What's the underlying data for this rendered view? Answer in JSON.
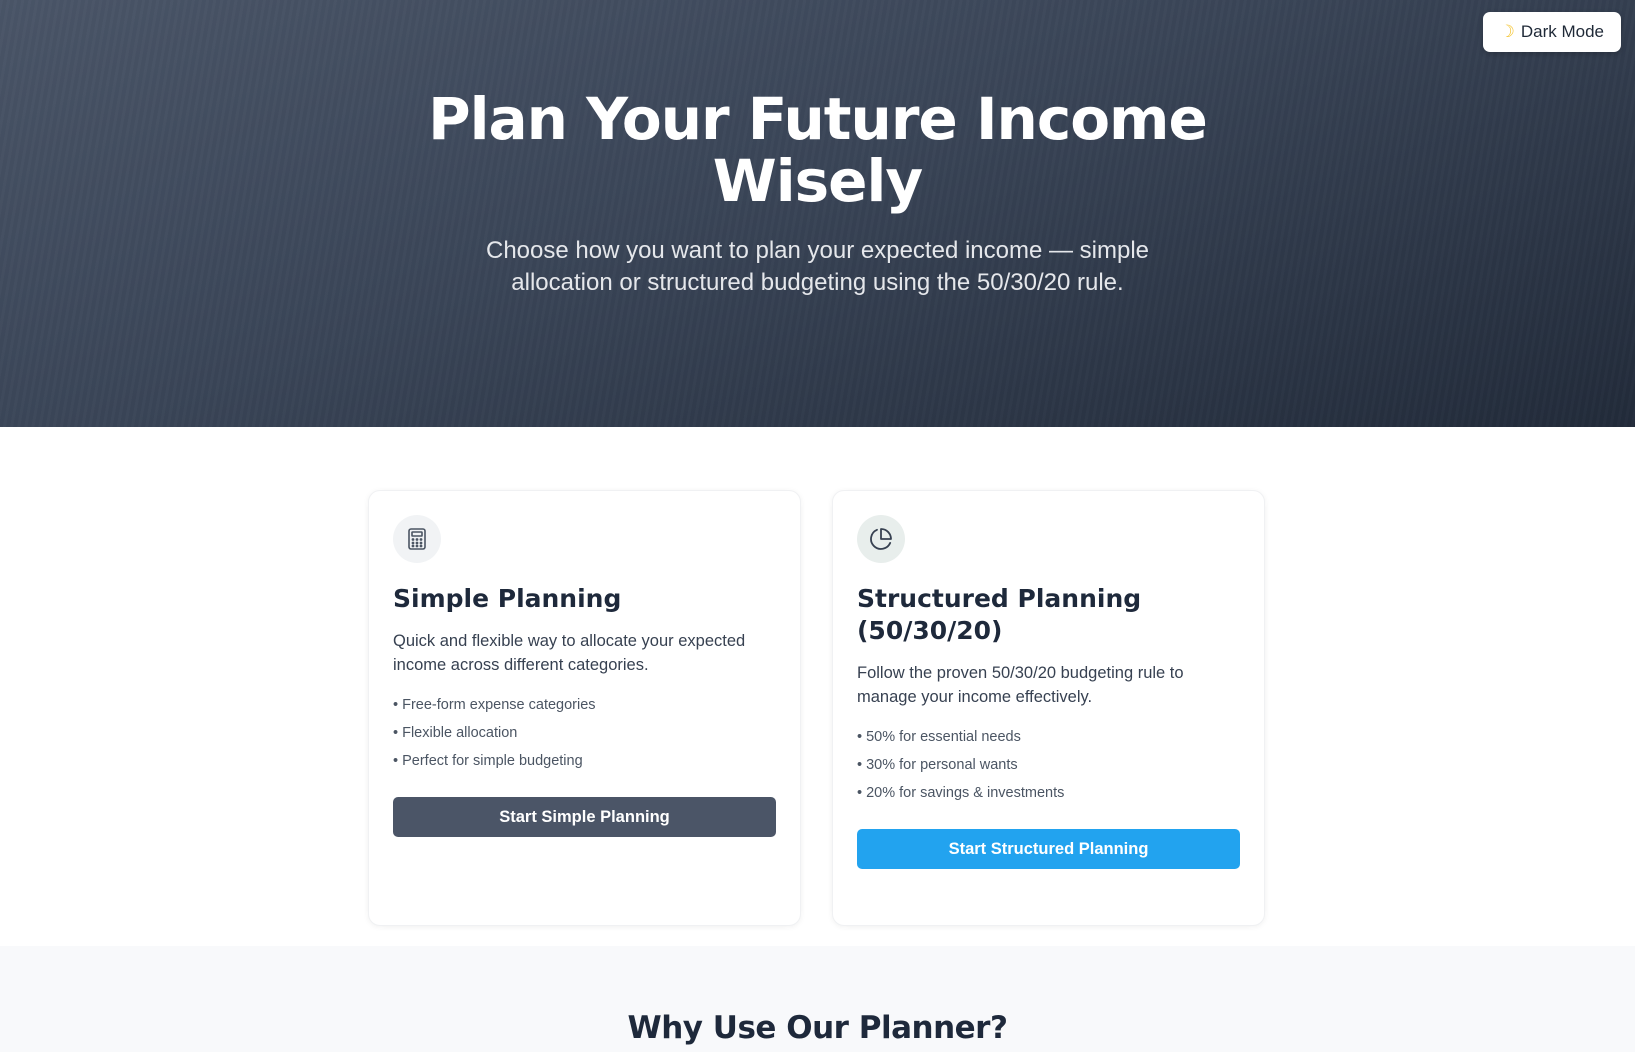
{
  "theme_toggle": {
    "icon": "moon-icon",
    "label": "Dark Mode"
  },
  "hero": {
    "title": "Plan Your Future Income Wisely",
    "subtitle": "Choose how you want to plan your expected income — simple allocation or structured budgeting using the 50/30/20 rule."
  },
  "cards": [
    {
      "icon": "calculator-icon",
      "title": "Simple Planning",
      "description": "Quick and flexible way to allocate your expected income across different categories.",
      "features": [
        "• Free-form expense categories",
        "• Flexible allocation",
        "• Perfect for simple budgeting"
      ],
      "button_label": "Start Simple Planning",
      "button_color": "#4b5567"
    },
    {
      "icon": "pie-chart-icon",
      "title": "Structured Planning (50/30/20)",
      "description": "Follow the proven 50/30/20 budgeting rule to manage your income effectively.",
      "features": [
        "• 50% for essential needs",
        "• 30% for personal wants",
        "• 20% for savings & investments"
      ],
      "button_label": "Start Structured Planning",
      "button_color": "#22a3ef"
    }
  ],
  "why_section": {
    "title": "Why Use Our Planner?"
  }
}
